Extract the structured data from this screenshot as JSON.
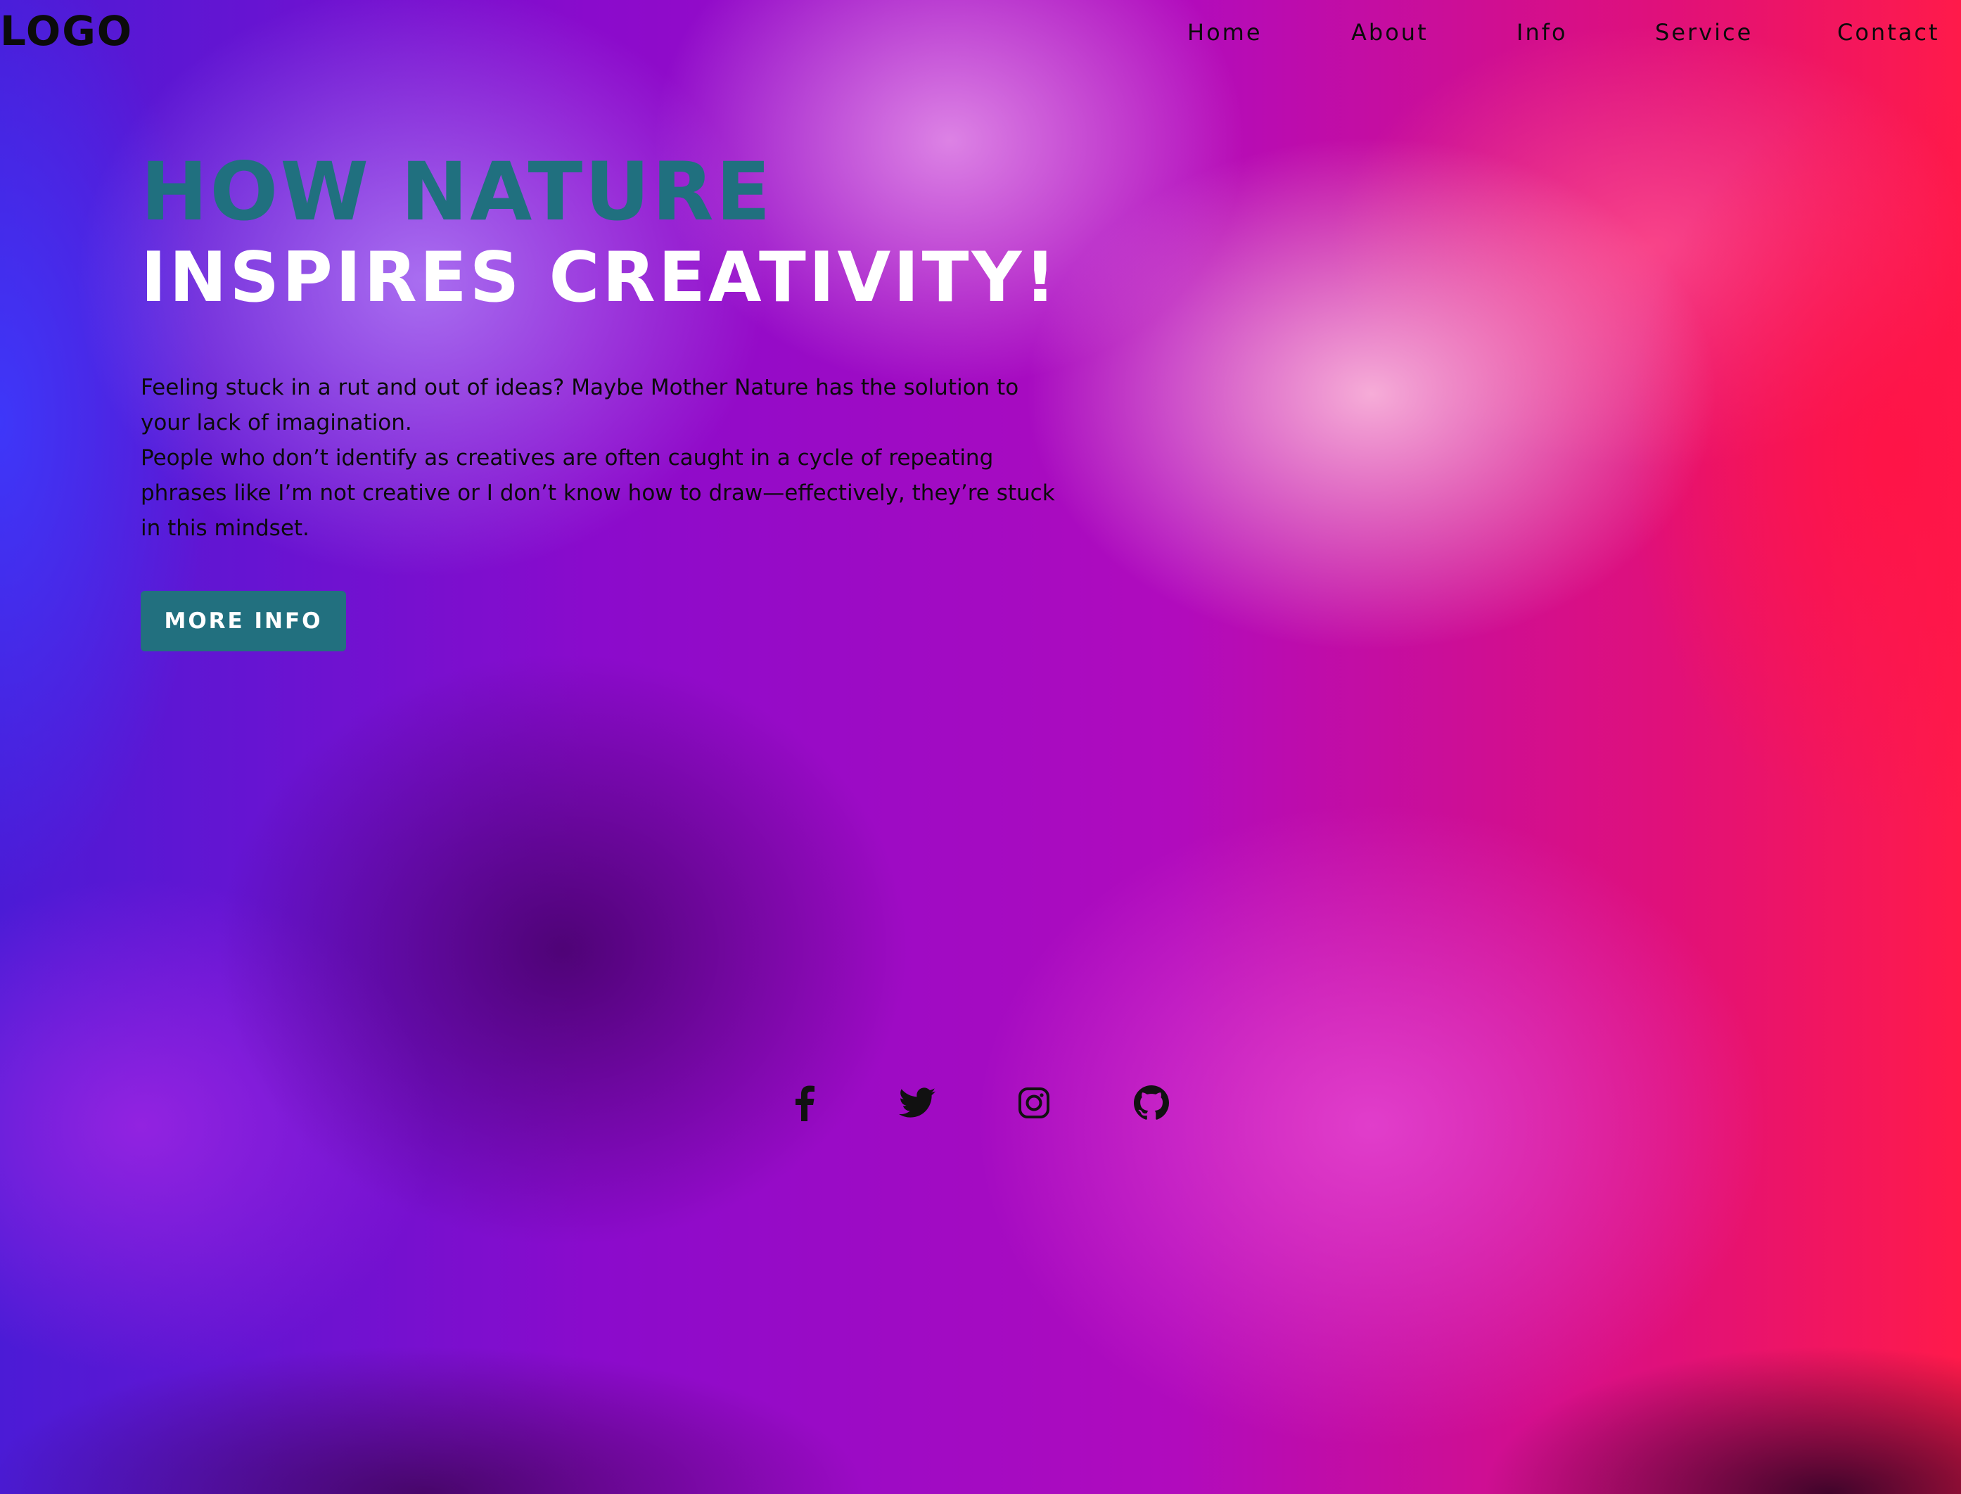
{
  "header": {
    "logo": "LOGO",
    "nav": [
      {
        "label": "Home"
      },
      {
        "label": "About"
      },
      {
        "label": "Info"
      },
      {
        "label": "Service"
      },
      {
        "label": "Contact"
      }
    ]
  },
  "hero": {
    "headline_line1": "HOW NATURE",
    "headline_line2": "INSPIRES CREATIVITY!",
    "paragraph_1": "Feeling stuck in a rut and out of ideas? Maybe Mother Nature has the solution to your lack of imagination.",
    "paragraph_2": "People who don’t identify as creatives are often caught in a cycle of repeating phrases like I’m not creative or I don’t know how to draw—effectively, they’re stuck in this mindset.",
    "button_label": "MORE INFO"
  },
  "colors": {
    "accent_teal": "#22707f",
    "text_dark": "#0b0b0b",
    "headline_white": "#ffffff"
  },
  "social": [
    {
      "icon": "facebook-icon"
    },
    {
      "icon": "twitter-icon"
    },
    {
      "icon": "instagram-icon"
    },
    {
      "icon": "github-icon"
    }
  ]
}
